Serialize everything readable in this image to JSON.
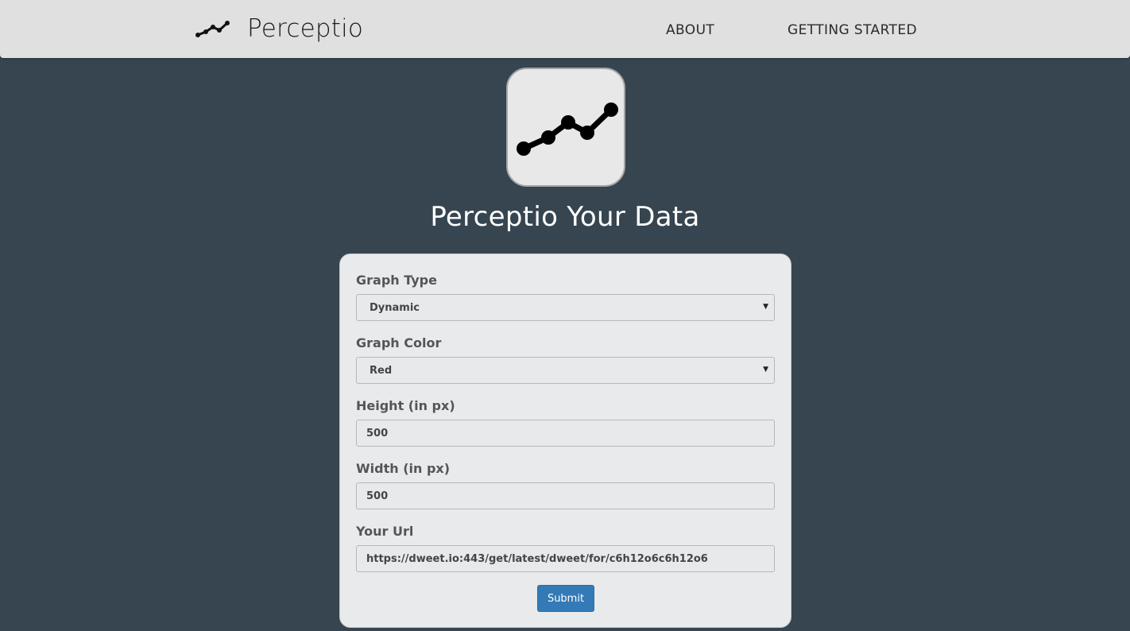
{
  "navbar": {
    "brand": "Perceptio",
    "brand_icon": "line-chart-icon",
    "links": [
      {
        "label": "ABOUT"
      },
      {
        "label": "GETTING STARTED"
      }
    ]
  },
  "hero": {
    "logo_icon": "line-chart-icon",
    "title": "Perceptio Your Data"
  },
  "form": {
    "graph_type": {
      "label": "Graph Type",
      "value": "Dynamic"
    },
    "graph_color": {
      "label": "Graph Color",
      "value": "Red"
    },
    "height": {
      "label": "Height (in px)",
      "value": "500"
    },
    "width": {
      "label": "Width (in px)",
      "value": "500"
    },
    "url": {
      "label": "Your Url",
      "value": "https://dweet.io:443/get/latest/dweet/for/c6h12o6c6h12o6"
    },
    "submit_label": "Submit"
  },
  "colors": {
    "page_background": "#36454f",
    "navbar_background": "#e0e0e0",
    "card_background": "#e9eaec",
    "submit_button": "#337ab7"
  }
}
